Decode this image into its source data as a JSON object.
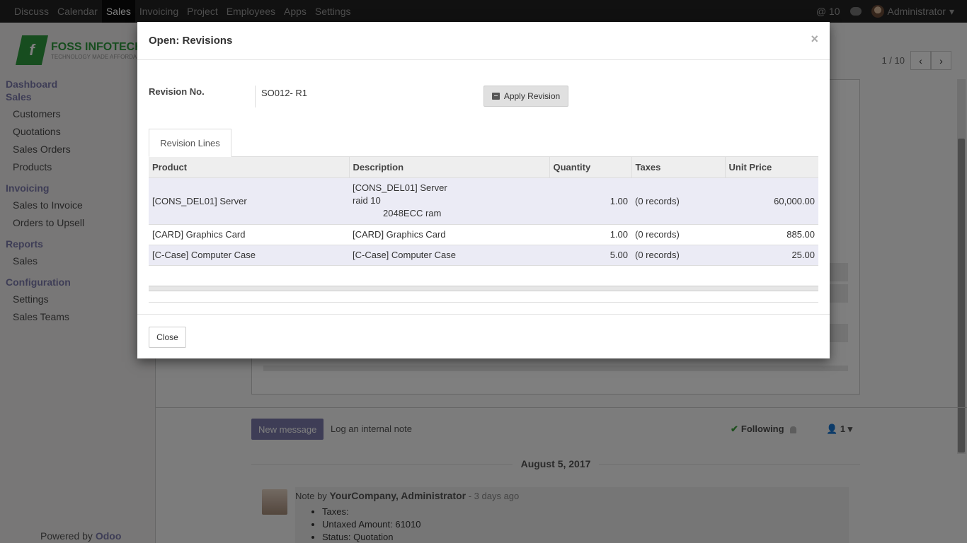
{
  "navbar": {
    "menu": [
      "Discuss",
      "Calendar",
      "Sales",
      "Invoicing",
      "Project",
      "Employees",
      "Apps",
      "Settings"
    ],
    "active": "Sales",
    "notifications": "@ 10",
    "user": "Administrator"
  },
  "logo": {
    "title": "FOSS INFOTECH",
    "subtitle": "TECHNOLOGY MADE AFFORDABLE"
  },
  "sidebar": {
    "sections": [
      {
        "label": "Dashboard"
      },
      {
        "label": "Sales",
        "items": [
          "Customers",
          "Quotations",
          "Sales Orders",
          "Products"
        ]
      },
      {
        "label": "Invoicing",
        "items": [
          "Sales to Invoice",
          "Orders to Upsell"
        ]
      },
      {
        "label": "Reports",
        "items": [
          "Sales"
        ]
      },
      {
        "label": "Configuration",
        "items": [
          "Settings",
          "Sales Teams"
        ]
      }
    ],
    "powered_by": "Powered by",
    "powered_brand": "Odoo"
  },
  "pager": {
    "text": "1 / 10"
  },
  "chatter": {
    "new_message": "New message",
    "log_note": "Log an internal note",
    "following": "Following",
    "followers": "1",
    "date": "August 5, 2017",
    "note_prefix": "Note by",
    "note_author": "YourCompany, Administrator",
    "note_time": "- 3 days ago",
    "note_items": [
      "Taxes:",
      "Untaxed Amount: 61010",
      "Status: Quotation"
    ]
  },
  "modal": {
    "title": "Open: Revisions",
    "close_symbol": "×",
    "revision_label": "Revision No.",
    "revision_value": "SO012- R1",
    "apply_button": "Apply Revision",
    "tab": "Revision Lines",
    "columns": [
      "Product",
      "Description",
      "Quantity",
      "Taxes",
      "Unit Price"
    ],
    "rows": [
      {
        "product": "[CONS_DEL01] Server",
        "description": [
          "[CONS_DEL01] Server",
          "raid 10",
          "2048ECC ram"
        ],
        "quantity": "1.00",
        "taxes": "(0 records)",
        "unit_price": "60,000.00"
      },
      {
        "product": "[CARD] Graphics Card",
        "description": [
          "[CARD] Graphics Card"
        ],
        "quantity": "1.00",
        "taxes": "(0 records)",
        "unit_price": "885.00"
      },
      {
        "product": "[C-Case] Computer Case",
        "description": [
          "[C-Case] Computer Case"
        ],
        "quantity": "5.00",
        "taxes": "(0 records)",
        "unit_price": "25.00"
      }
    ],
    "close_button": "Close"
  }
}
